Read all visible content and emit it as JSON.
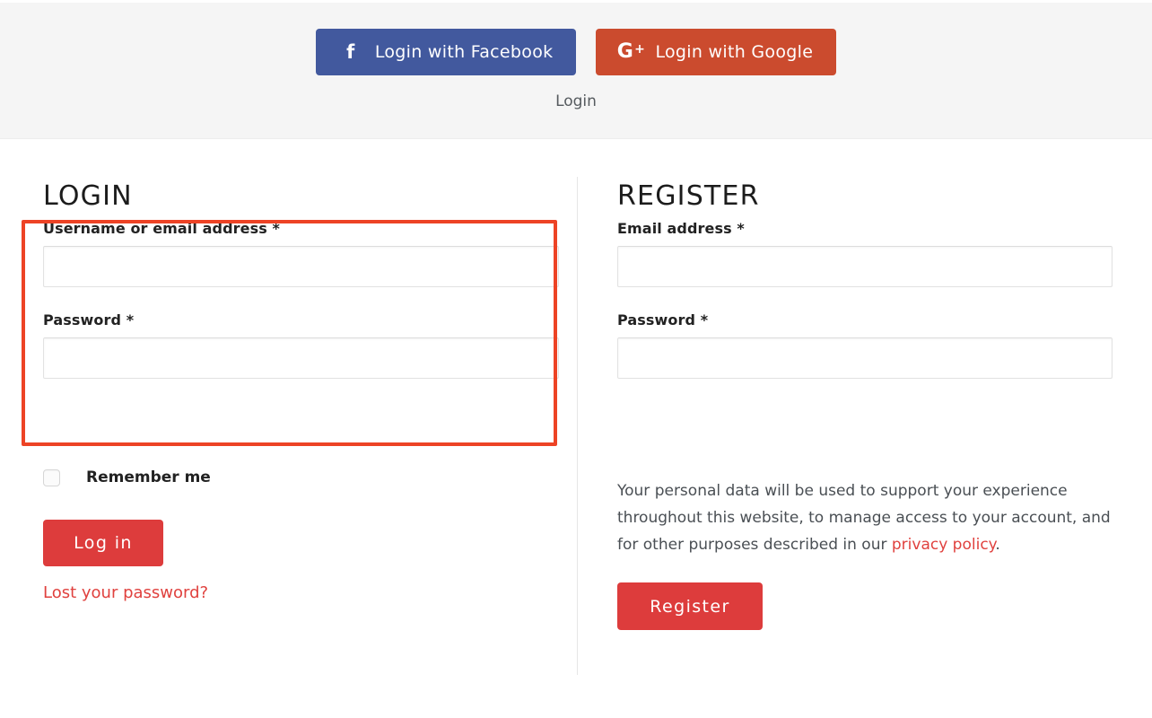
{
  "social": {
    "facebook_button": {
      "label": "Login with Facebook",
      "icon": "facebook-f-icon",
      "color": "#42599e"
    },
    "google_button": {
      "label": "Login with Google",
      "icon_letter": "G",
      "icon_plus": "+",
      "icon": "google-plus-icon",
      "color": "#cb4b2e"
    },
    "caption": "Login"
  },
  "login": {
    "title": "LOGIN",
    "username_label": "Username or email address *",
    "username_value": "",
    "username_placeholder": "",
    "password_label": "Password *",
    "password_value": "",
    "password_placeholder": "",
    "remember_label": "Remember me",
    "remember_checked": false,
    "submit_label": "Log in",
    "lost_password_label": "Lost your password?"
  },
  "register": {
    "title": "REGISTER",
    "email_label": "Email address *",
    "email_value": "",
    "email_placeholder": "",
    "password_label": "Password *",
    "password_value": "",
    "password_placeholder": "",
    "privacy_text_before": "Your personal data will be used to support your experience throughout this website, to manage access to your account, and for other purposes described in our ",
    "privacy_link_label": "privacy policy",
    "privacy_text_after": ".",
    "submit_label": "Register"
  },
  "colors": {
    "accent_red": "#dd3c3c",
    "link_red": "#e0413e",
    "highlight_border": "#ed4325",
    "facebook_blue": "#42599e",
    "google_red": "#cb4b2e",
    "band_background": "#f5f5f5"
  }
}
